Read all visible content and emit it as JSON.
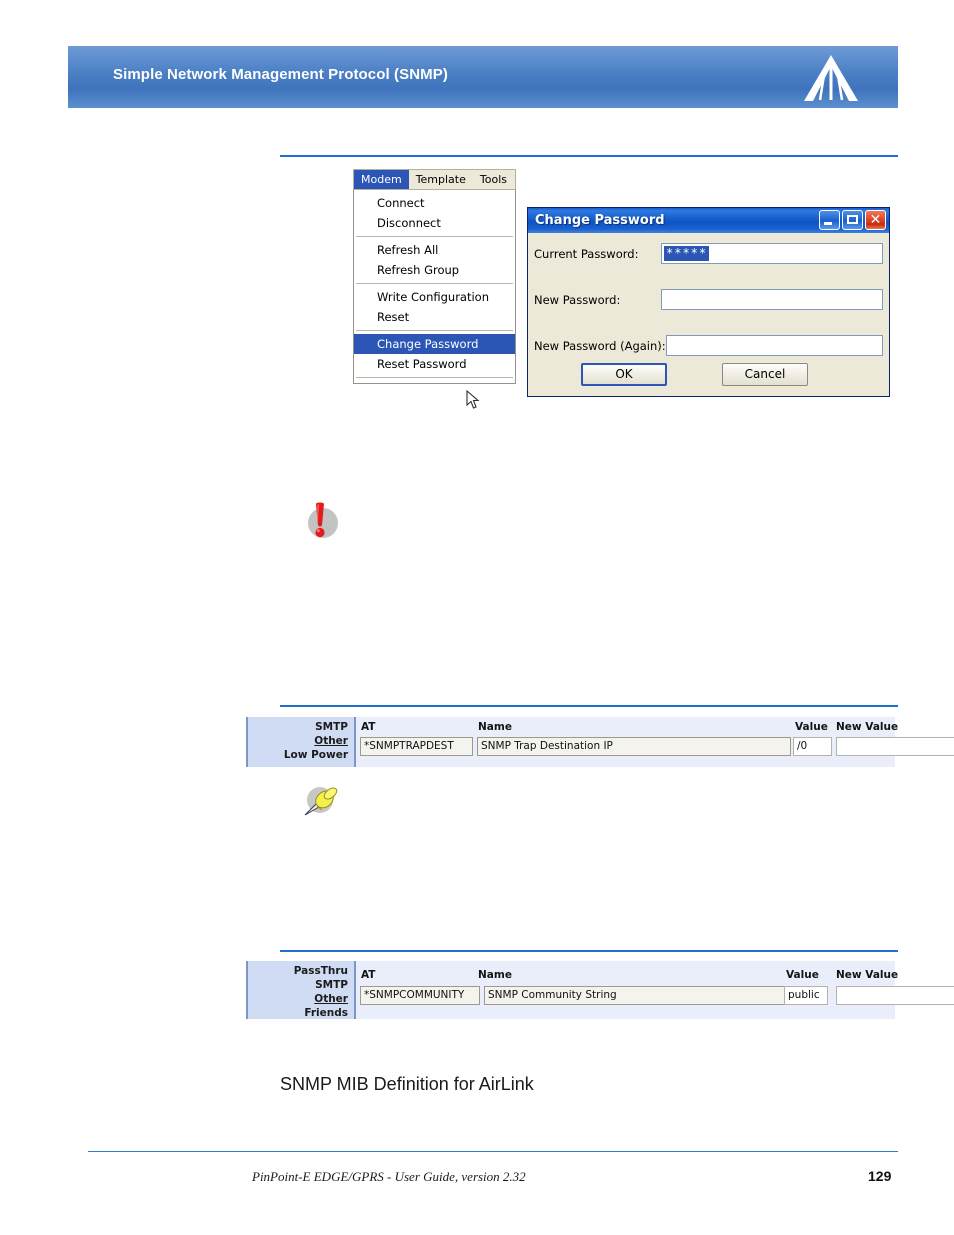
{
  "header": {
    "title": "Simple Network Management Protocol (SNMP)",
    "logo_icon": "airlink-logo-icon",
    "banner_color": "#4a7fc4"
  },
  "screenshot_menu": {
    "menubar": [
      {
        "label": "Modem",
        "active": true
      },
      {
        "label": "Template",
        "active": false
      },
      {
        "label": "Tools",
        "active": false
      }
    ],
    "groups": [
      {
        "items": [
          {
            "label": "Connect",
            "selected": false
          },
          {
            "label": "Disconnect",
            "selected": false
          }
        ]
      },
      {
        "items": [
          {
            "label": "Refresh All",
            "selected": false
          },
          {
            "label": "Refresh Group",
            "selected": false
          }
        ]
      },
      {
        "items": [
          {
            "label": "Write Configuration",
            "selected": false
          },
          {
            "label": "Reset",
            "selected": false
          }
        ]
      },
      {
        "items": [
          {
            "label": "Change Password",
            "selected": true
          },
          {
            "label": "Reset Password",
            "selected": false
          }
        ]
      }
    ],
    "cursor_icon": "mouse-pointer-icon"
  },
  "dialog": {
    "title": "Change Password",
    "titlebar_color": "#0d53c6",
    "window_buttons": [
      {
        "icon": "minimize-icon",
        "label": "_"
      },
      {
        "icon": "maximize-icon",
        "label": "□"
      },
      {
        "icon": "close-icon",
        "label": "✕"
      }
    ],
    "fields": [
      {
        "label": "Current Password:",
        "value": "*****",
        "selected": true,
        "placeholder": ""
      },
      {
        "label": "New Password:",
        "value": "",
        "selected": false,
        "placeholder": ""
      },
      {
        "label": "New Password (Again):",
        "value": "",
        "selected": false,
        "placeholder": ""
      }
    ],
    "ok_label": "OK",
    "cancel_label": "Cancel"
  },
  "warning_note": {
    "icon": "warning-exclamation-icon",
    "icon_color": "#e02020"
  },
  "tip_note": {
    "icon": "pushpin-icon",
    "icon_color": "#f2e23c"
  },
  "at_table_trapdest": {
    "nav_items": [
      {
        "label": "SMTP",
        "link": false
      },
      {
        "label": "Other",
        "link": true
      },
      {
        "label": "Low Power",
        "link": false
      }
    ],
    "columns": [
      "AT",
      "Name",
      "Value",
      "New Value"
    ],
    "row": {
      "at": "*SNMPTRAPDEST",
      "name": "SNMP Trap Destination IP",
      "value": "/0",
      "new_value": ""
    }
  },
  "at_table_community": {
    "nav_items": [
      {
        "label": "PassThru",
        "link": false
      },
      {
        "label": "SMTP",
        "link": false
      },
      {
        "label": "Other",
        "link": true
      },
      {
        "label": "Friends",
        "link": false
      }
    ],
    "columns": [
      "AT",
      "Name",
      "Value",
      "New Value"
    ],
    "row": {
      "at": "*SNMPCOMMUNITY",
      "name": "SNMP Community String",
      "value": "public",
      "new_value": ""
    }
  },
  "section": {
    "heading": "SNMP MIB Definition for AirLink"
  },
  "footer": {
    "text": "PinPoint-E EDGE/GPRS - User Guide, version 2.32",
    "page_number": "129",
    "rule_color": "#1f6fcf"
  }
}
